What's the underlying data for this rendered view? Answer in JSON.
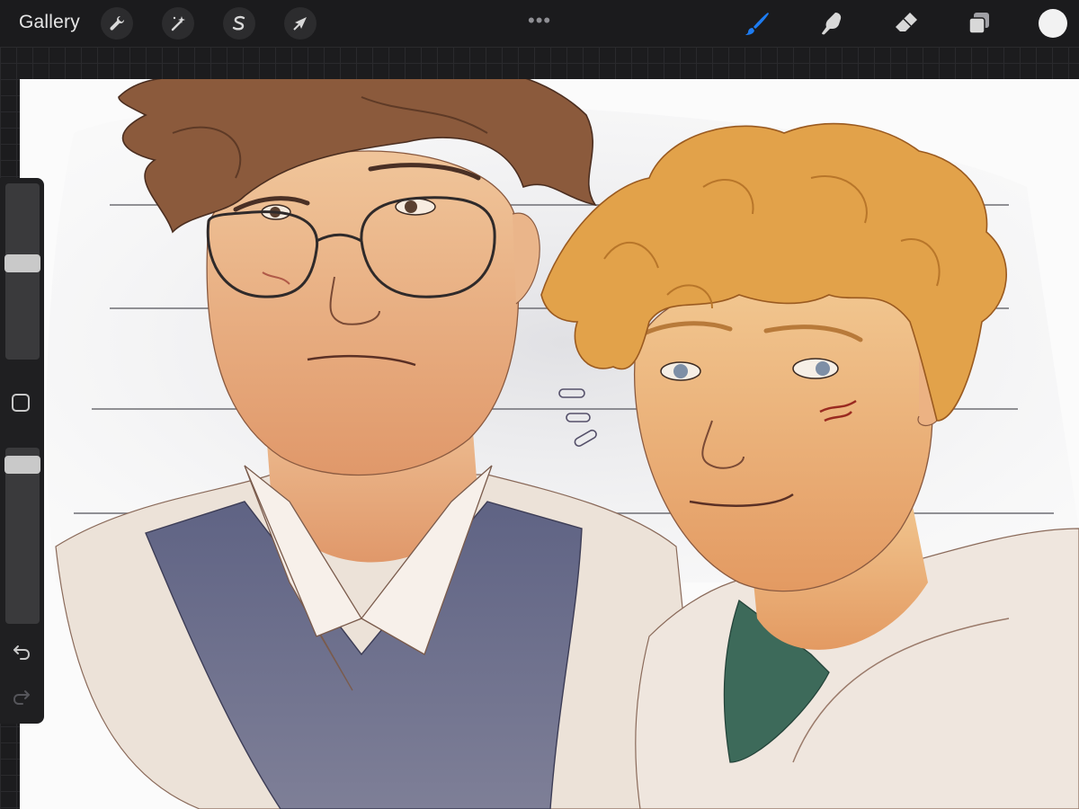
{
  "toolbar": {
    "gallery_label": "Gallery",
    "left_tools": [
      {
        "name": "actions",
        "icon": "wrench-icon"
      },
      {
        "name": "adjustments",
        "icon": "magic-wand-icon"
      },
      {
        "name": "selection",
        "icon": "selection-s-icon"
      },
      {
        "name": "transform",
        "icon": "arrow-cursor-icon"
      }
    ],
    "more_label": "•••",
    "right_tools": [
      {
        "name": "brush",
        "icon": "brush-icon",
        "active": true,
        "color": "#1d7cf2"
      },
      {
        "name": "smudge",
        "icon": "smudge-finger-icon",
        "active": false
      },
      {
        "name": "eraser",
        "icon": "eraser-icon",
        "active": false
      },
      {
        "name": "layers",
        "icon": "layers-icon",
        "active": false
      }
    ],
    "current_color": "#f2f2f2"
  },
  "sidebar": {
    "brush_size_level": 0.45,
    "opacity_level": 0.05,
    "modify_button": "square-modifier-icon",
    "undo_icon": "undo-arrow-icon",
    "redo_icon": "redo-arrow-icon"
  },
  "canvas": {
    "background": "#fbfbfb",
    "artwork": "illustration-two-characters"
  }
}
